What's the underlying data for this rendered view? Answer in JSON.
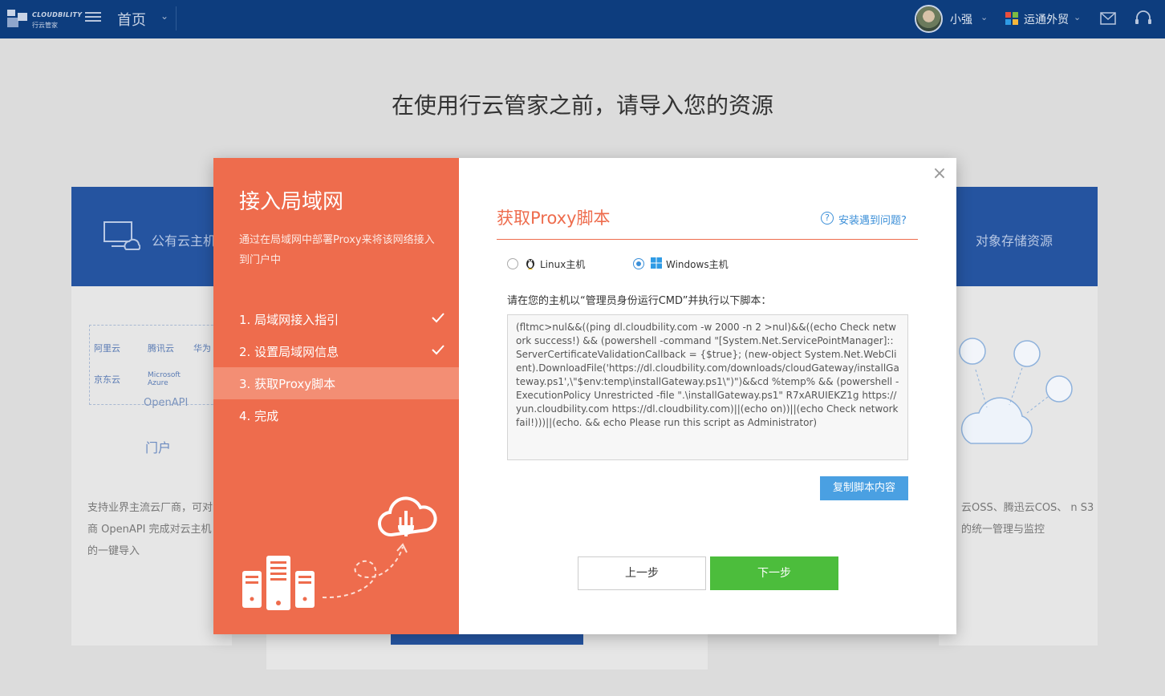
{
  "topbar": {
    "brand": "CLOUDBILITY",
    "brand_sub": "行云管家",
    "home_label": "首页",
    "user_name": "小强",
    "org_name": "运通外贸"
  },
  "background": {
    "page_title": "在使用行云管家之前，请导入您的资源",
    "left_card": {
      "heading": "公有云主机",
      "providers": [
        "阿里云",
        "腾讯云",
        "华为",
        "京东云",
        "Microsoft Azure"
      ],
      "openapi_label": "OpenAPI",
      "portal_label": "门户",
      "description": "支持业界主流云厂商，可对 厂商 OpenAPI 完成对云主机 源的一键导入"
    },
    "right_card": {
      "heading": "对象存储资源",
      "description": "云OSS、腾迅云COS、 n S3的统一管理与监控"
    }
  },
  "modal": {
    "left": {
      "title": "接入局域网",
      "description": "通过在局域网中部署Proxy来将该网络接入到门户中",
      "steps": [
        {
          "label": "1. 局域网接入指引",
          "done": true
        },
        {
          "label": "2. 设置局域网信息",
          "done": true
        },
        {
          "label": "3. 获取Proxy脚本",
          "done": false,
          "active": true
        },
        {
          "label": "4. 完成",
          "done": false
        }
      ]
    },
    "right": {
      "title": "获取Proxy脚本",
      "help_text": "安装遇到问题?",
      "os_options": [
        {
          "label": "Linux主机",
          "selected": false,
          "icon": "linux-penguin-icon"
        },
        {
          "label": "Windows主机",
          "selected": true,
          "icon": "windows-logo-icon"
        }
      ],
      "instruction": "请在您的主机以“管理员身份运行CMD”并执行以下脚本：",
      "script": "(fltmc>nul&&((ping dl.cloudbility.com -w 2000 -n 2 >nul)&&((echo Check network success!) && (powershell -command \"[System.Net.ServicePointManager]::ServerCertificateValidationCallback = {$true}; (new-object System.Net.WebClient).DownloadFile('https://dl.cloudbility.com/downloads/cloudGateway/installGateway.ps1',\\\"$env:temp\\installGateway.ps1\\\")\")&&cd %temp% && (powershell -ExecutionPolicy Unrestricted -file \".\\installGateway.ps1\" R7xARUIEKZ1g https://yun.cloudbility.com https://dl.cloudbility.com)||(echo on))||(echo Check network fail!)))||(echo. && echo Please run this script as Administrator)",
      "copy_label": "复制脚本内容",
      "prev_label": "上一步",
      "next_label": "下一步"
    }
  },
  "colors": {
    "topbar": "#0d3d7e",
    "modal_accent": "#ee6c4d",
    "copy_button": "#4aa0e2",
    "next_button": "#4cbd3c",
    "link": "#3b8fd8"
  }
}
